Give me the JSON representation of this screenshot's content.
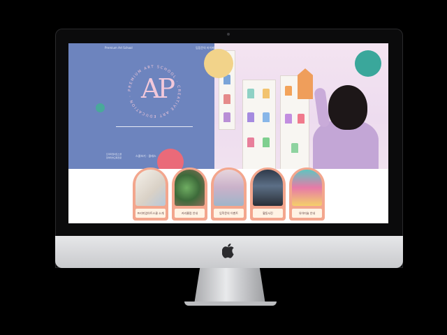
{
  "header": {
    "brand": "Premium Art School",
    "nav": "입점문의 마이페이지 회원"
  },
  "hero": {
    "logo_letters": "AP",
    "ring_text": "PREMIUM ART SCHOOL · CREATIVE ART EDUCATION ·",
    "side_text_1": "프리미엄아트스쿨",
    "side_text_2": "창의미술교육전문",
    "side_buttons": "스쿨보기 · 클래스"
  },
  "cards": [
    {
      "label": "프리미엄아트스쿨 소개"
    },
    {
      "label": "커리큘럼 안내"
    },
    {
      "label": "입학문의 이벤트"
    },
    {
      "label": "활동사진"
    },
    {
      "label": "유아미술 안내"
    }
  ],
  "colors": {
    "hero_left": "#6d84be",
    "logo_pink": "#f2c8da",
    "coral": "#ea6a79",
    "teal": "#3aa79b",
    "card": "#f3a68d"
  },
  "icons": {
    "apple": "apple-logo-icon"
  }
}
